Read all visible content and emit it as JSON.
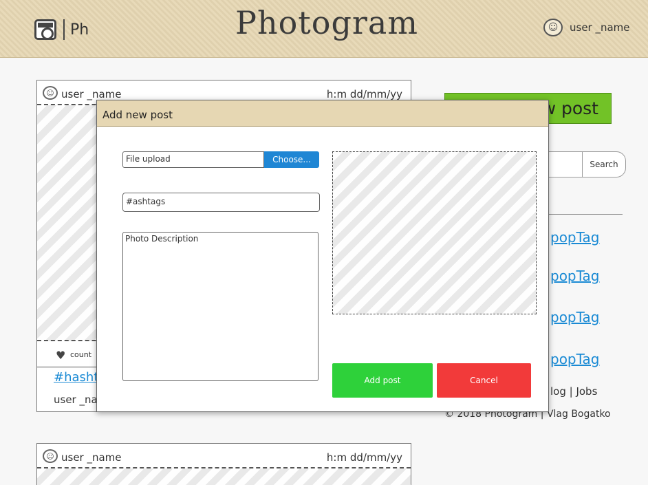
{
  "header": {
    "logo_text": "Ph",
    "app_title": "Photogram",
    "user_name": "user _name"
  },
  "posts": [
    {
      "user": "user _name",
      "timestamp": "h:m dd/mm/yy",
      "likes_label": "count",
      "hashtags": "#hasht",
      "author": "user _na"
    },
    {
      "user": "user _name",
      "timestamp": "h:m dd/mm/yy"
    }
  ],
  "sidebar": {
    "add_post_label": "new post",
    "search_button": "Search",
    "tags": [
      "popTag",
      "popTag",
      "popTag",
      "popTag"
    ],
    "footer_links": "log | Jobs",
    "copyright": "© 2018 Photogram | Vlag Bogatko"
  },
  "modal": {
    "title": "Add new post",
    "file_placeholder": "File upload",
    "choose_label": "Choose...",
    "hashtags_placeholder": "#ashtags",
    "description_placeholder": "Photo Description",
    "add_post_label": "Add post",
    "cancel_label": "Cancel"
  },
  "colors": {
    "header_bg": "#e6d7b3",
    "link_blue": "#1a8ad4",
    "add_green": "#2ed13a",
    "cancel_red": "#f23a3a",
    "choose_blue": "#1f86d4",
    "sidebar_green": "#72c227"
  }
}
